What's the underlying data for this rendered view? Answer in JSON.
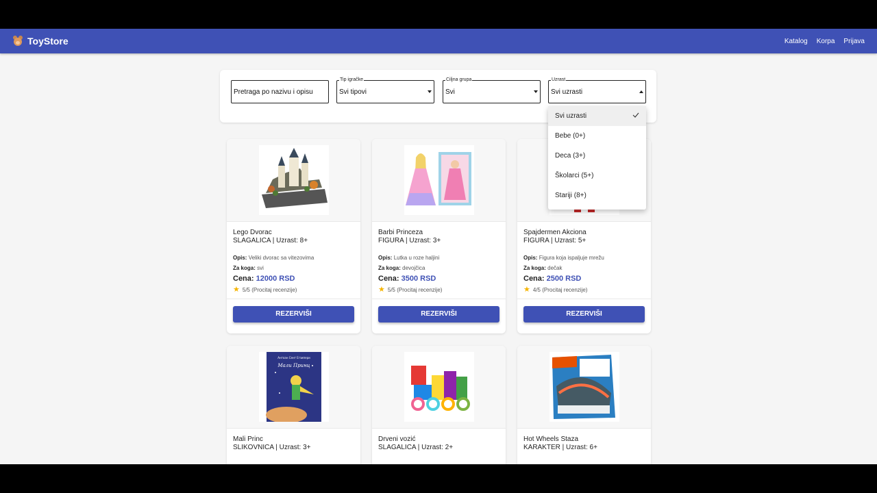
{
  "navbar": {
    "brand": "ToyStore",
    "links": [
      "Katalog",
      "Korpa",
      "Prijava"
    ]
  },
  "filters": {
    "search": {
      "placeholder": "Pretraga po nazivu i opisu"
    },
    "type": {
      "label": "Tip igračke",
      "value": "Svi tipovi"
    },
    "group": {
      "label": "Ciljna grupa",
      "value": "Svi"
    },
    "age": {
      "label": "Uzrast",
      "value": "Svi uzrasti"
    }
  },
  "age_options": [
    "Svi uzrasti",
    "Bebe (0+)",
    "Deca (3+)",
    "Školarci (5+)",
    "Stariji (8+)"
  ],
  "labels": {
    "desc": "Opis:",
    "for": "Za koga:",
    "price": "Cena:",
    "reserve": "REZERVIŠI"
  },
  "products": [
    {
      "name": "Lego Dvorac",
      "meta": "SLAGALICA | Uzrast: 8+",
      "desc": "Veliki dvorac sa vitezovima",
      "for": "svi",
      "price": "12000 RSD",
      "rating": "5/5 (Procitaj recenzije)"
    },
    {
      "name": "Barbi Princeza",
      "meta": "FIGURA | Uzrast: 3+",
      "desc": "Lutka u roze haljini",
      "for": "devojčica",
      "price": "3500 RSD",
      "rating": "5/5 (Procitaj recenzije)"
    },
    {
      "name": "Spajdermen Akciona",
      "meta": "FIGURA | Uzrast: 5+",
      "desc": "Figura koja ispaljuje mrežu",
      "for": "dečak",
      "price": "2500 RSD",
      "rating": "4/5 (Procitaj recenzije)"
    },
    {
      "name": "Mali Princ",
      "meta": "SLIKOVNICA | Uzrast: 3+"
    },
    {
      "name": "Drveni vozić",
      "meta": "SLAGALICA | Uzrast: 2+"
    },
    {
      "name": "Hot Wheels Staza",
      "meta": "KARAKTER | Uzrast: 6+"
    }
  ],
  "colors": {
    "primary": "#3f51b5",
    "star": "#f5b400",
    "background": "#f5f5f5"
  }
}
